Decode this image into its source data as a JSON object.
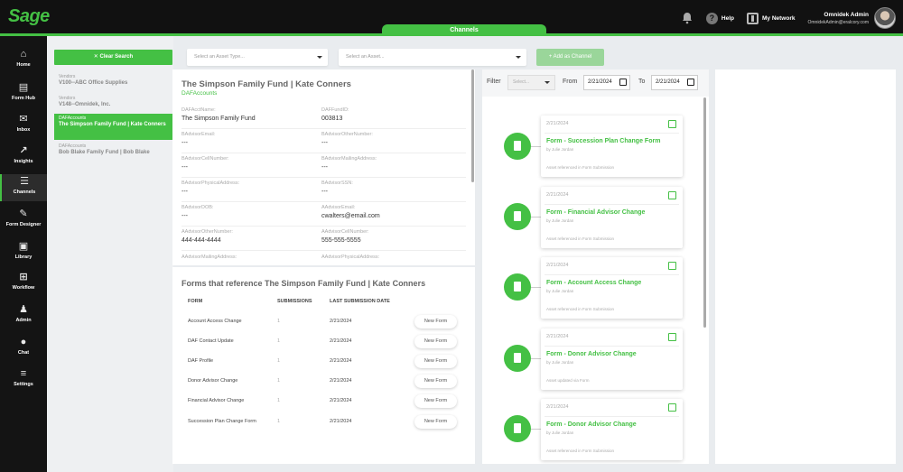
{
  "brand": {
    "logo": "Sage",
    "accent": "#44c044"
  },
  "topbar": {
    "help": "Help",
    "network": "My Network",
    "user_name": "Omnidek Admin",
    "user_email": "OmnidekAdmin@eralcory.com"
  },
  "channel_tab": "Channels",
  "nav": [
    {
      "label": "Home",
      "icon": "home-icon"
    },
    {
      "label": "Form Hub",
      "icon": "form-hub-icon"
    },
    {
      "label": "Inbox",
      "icon": "inbox-icon"
    },
    {
      "label": "Insights",
      "icon": "insights-icon"
    },
    {
      "label": "Channels",
      "icon": "channels-icon"
    },
    {
      "label": "Form Designer",
      "icon": "form-designer-icon"
    },
    {
      "label": "Library",
      "icon": "library-icon"
    },
    {
      "label": "Workflow",
      "icon": "workflow-icon"
    },
    {
      "label": "Admin",
      "icon": "admin-icon"
    },
    {
      "label": "Chat",
      "icon": "chat-icon"
    },
    {
      "label": "Settings",
      "icon": "settings-icon"
    }
  ],
  "vendors": {
    "clear_label": "Clear Search",
    "items": [
      {
        "type": "Vendors",
        "name": "V100--ABC Office Supplies"
      },
      {
        "type": "Vendors",
        "name": "V148--Omnidek, Inc."
      },
      {
        "type": "DAFAccounts",
        "name": "The Simpson Family Fund | Kate Conners"
      },
      {
        "type": "DAFAccounts",
        "name": "Bob Blake Family Fund | Bob Blake"
      }
    ]
  },
  "toolbar": {
    "asset_type_placeholder": "Select an Asset Type...",
    "asset_placeholder": "Select an Asset...",
    "add_channel": "Add as Channel"
  },
  "detail": {
    "title": "The Simpson Family Fund | Kate Conners",
    "subtitle": "DAFAccounts",
    "fields": [
      {
        "label": "DAFAcctName:",
        "value": "The Simpson Family Fund"
      },
      {
        "label": "DAFFundID:",
        "value": "003813"
      },
      {
        "label": "BAdvisorEmail:",
        "value": "---"
      },
      {
        "label": "BAdvisorOtherNumber:",
        "value": "---"
      },
      {
        "label": "BAdvisorCellNumber:",
        "value": "---"
      },
      {
        "label": "BAdvisorMailingAddress:",
        "value": "---"
      },
      {
        "label": "BAdvisorPhysicalAddress:",
        "value": "---"
      },
      {
        "label": "BAdvisorSSN:",
        "value": "---"
      },
      {
        "label": "BAdvisorDOB:",
        "value": "---"
      },
      {
        "label": "AAdvisorEmail:",
        "value": "cwalters@email.com"
      },
      {
        "label": "AAdvisorOtherNumber:",
        "value": "444-444-4444"
      },
      {
        "label": "AAdvisorCellNumber:",
        "value": "555-555-5555"
      },
      {
        "label": "AAdvisorMailingAddress:",
        "value": ""
      },
      {
        "label": "AAdvisorPhysicalAddress:",
        "value": ""
      }
    ]
  },
  "forms": {
    "title": "Forms that reference The Simpson Family Fund | Kate Conners",
    "headers": [
      "FORM",
      "SUBMISSIONS",
      "LAST SUBMISSION DATE"
    ],
    "new_form_label": "New Form",
    "rows": [
      {
        "form": "Account Access Change",
        "submissions": "1",
        "date": "2/21/2024"
      },
      {
        "form": "DAF Contact Update",
        "submissions": "1",
        "date": "2/21/2024"
      },
      {
        "form": "DAF Profile",
        "submissions": "1",
        "date": "2/21/2024"
      },
      {
        "form": "Donor Advisor Change",
        "submissions": "1",
        "date": "2/21/2024"
      },
      {
        "form": "Financial Advisor Change",
        "submissions": "1",
        "date": "2/21/2024"
      },
      {
        "form": "Succession Plan Change Form",
        "submissions": "1",
        "date": "2/21/2024"
      }
    ]
  },
  "timeline": {
    "filter_label": "Filter",
    "filter_placeholder": "Select...",
    "from_label": "From",
    "to_label": "To",
    "from_date": "2/21/2024",
    "to_date": "2/21/2024",
    "cards": [
      {
        "date": "2/21/2024",
        "name": "Form - Succession Plan Change Form",
        "by": "by Julie Jordan",
        "note": "Asset referenced in Form Submission"
      },
      {
        "date": "2/21/2024",
        "name": "Form - Financial Advisor Change",
        "by": "by Julie Jordan",
        "note": "Asset referenced in Form Submission"
      },
      {
        "date": "2/21/2024",
        "name": "Form - Account Access Change",
        "by": "by Julie Jordan",
        "note": "Asset referenced in Form Submission"
      },
      {
        "date": "2/21/2024",
        "name": "Form - Donor Advisor Change",
        "by": "by Julie Jordan",
        "note": "Asset updated via Form"
      },
      {
        "date": "2/21/2024",
        "name": "Form - Donor Advisor Change",
        "by": "by Julie Jordan",
        "note": "Asset referenced in Form Submission"
      }
    ]
  }
}
